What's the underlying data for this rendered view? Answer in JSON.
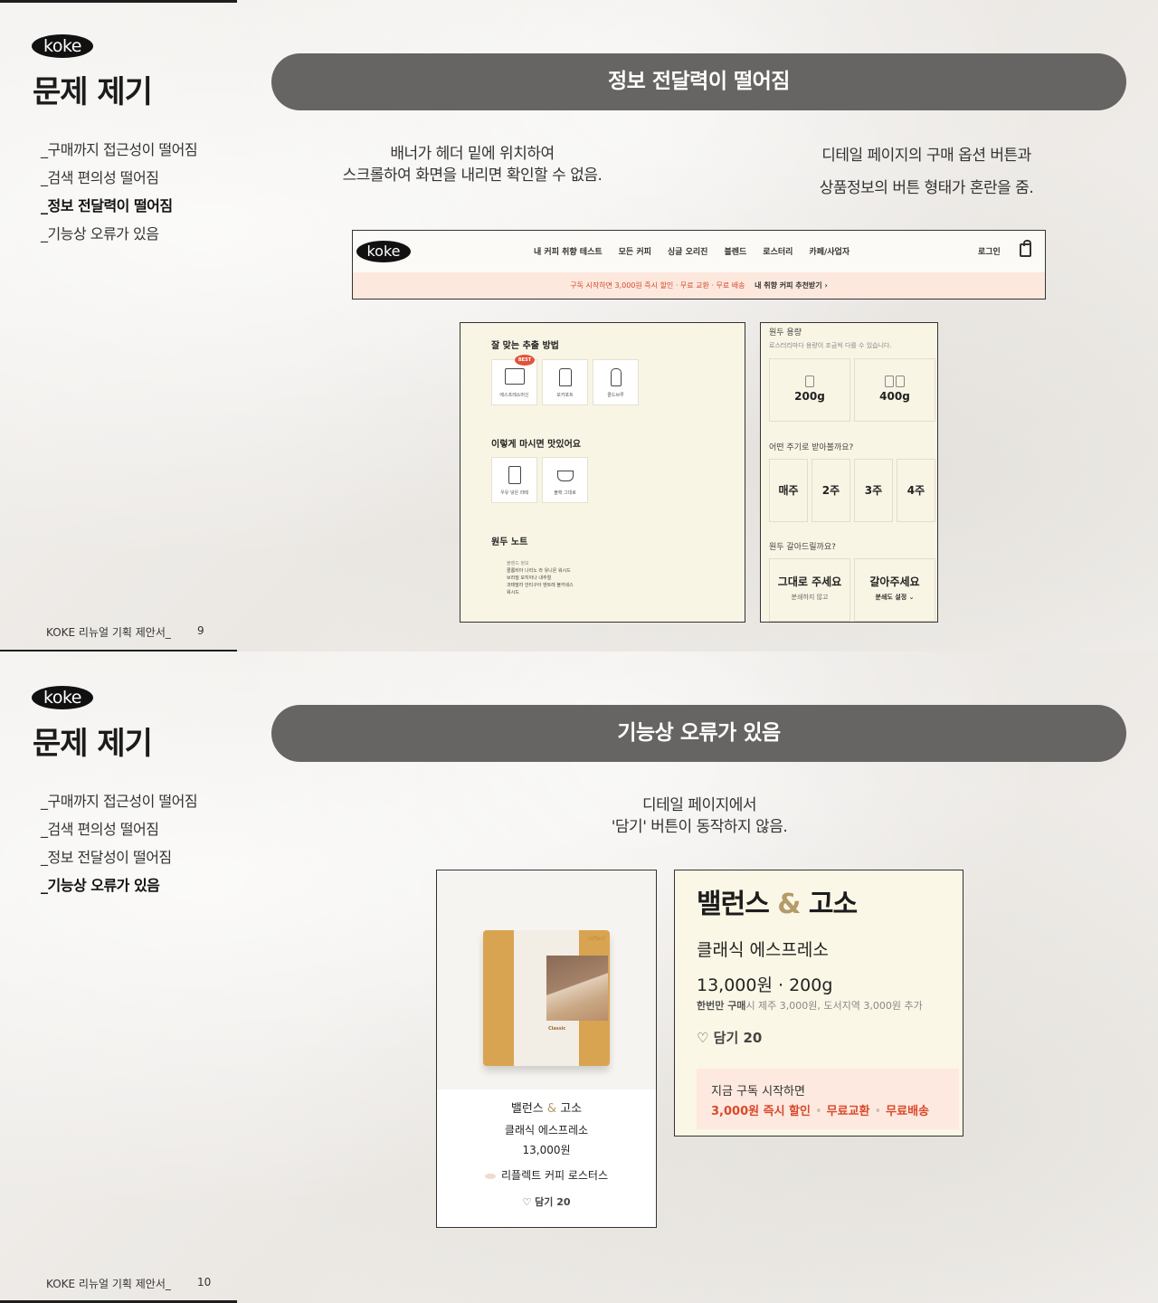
{
  "slides": [
    {
      "logo": "koke",
      "title": "문제 제기",
      "menu": [
        "_구매까지 접근성이 떨어짐",
        "_검색 편의성 떨어짐",
        "_정보 전달력이 떨어짐",
        "_기능상 오류가 있음"
      ],
      "active_index": 2,
      "footer": "KOKE 리뉴얼 기획 제안서_",
      "page_no": "9",
      "pill": "정보 전달력이 떨어짐",
      "desc_left": [
        "배너가 헤더 밑에 위치하여",
        "스크롤하여 화면을 내리면 확인할 수 없음."
      ],
      "desc_right": [
        "디테일 페이지의 구매 옵션 버튼과",
        "상품정보의 버튼 형태가 혼란을 줌."
      ],
      "header_mock": {
        "logo": "koke",
        "nav": [
          "내 커피 취향 테스트",
          "모든 커피",
          "싱글 오리진",
          "블렌드",
          "로스터리",
          "카페/사업자"
        ],
        "login": "로그인",
        "banner_text": "구독 시작하면 3,000원 즉시 할인 · 무료 교환 · 무료 배송",
        "banner_link": "내 취향 커피 추천받기 ›"
      },
      "brew_panel": {
        "h1": "잘 맞는 추출 방법",
        "best": "BEST",
        "methods": [
          "에스프레소머신",
          "모카포트",
          "콜드브루"
        ],
        "h2": "이렇게 마시면 맛있어요",
        "drinks": [
          "우유 넣은 라떼",
          "블랙 그대로"
        ],
        "h3": "원두 노트",
        "notes_title": "블렌드 정보",
        "notes": [
          "콜롬비아 나리노 라 유니온 워시드",
          "브라질 모지아나 내추럴",
          "과테말라 안티구아 엔트레 볼카네스",
          "워시드"
        ]
      },
      "option_panel": {
        "h1": "원두 용량",
        "sub1": "로스터리마다 용량이 조금씩 다를 수 있습니다.",
        "sizes": [
          "200g",
          "400g"
        ],
        "h2": "어떤 주기로 받아볼까요?",
        "cycles": [
          "매주",
          "2주",
          "3주",
          "4주"
        ],
        "h3": "원두 갈아드릴까요?",
        "grind": [
          {
            "title": "그대로 주세요",
            "sub": "분쇄하지 않고"
          },
          {
            "title": "갈아주세요",
            "sub": "분쇄도 설정 ⌄"
          }
        ]
      }
    },
    {
      "logo": "koke",
      "title": "문제 제기",
      "menu": [
        "_구매까지 접근성이 떨어짐",
        "_검색 편의성 떨어짐",
        "_정보 전달성이 떨어짐",
        "_기능상 오류가 있음"
      ],
      "active_index": 3,
      "footer": "KOKE 리뉴얼 기획 제안서_",
      "page_no": "10",
      "pill": "기능상 오류가 있음",
      "desc": [
        "디테일 페이지에서",
        "'담기' 버튼이 동작하지 않음."
      ],
      "product_card": {
        "brand_on_bag": "reflect",
        "bag_label": "Classic",
        "name_a": "밸런스",
        "amp": "&",
        "name_b": "고소",
        "sub": "클래식 에스프레소",
        "price": "13,000원",
        "roaster": "리플렉트 커피 로스터스",
        "like": "♡ 담기 20"
      },
      "detail_card": {
        "name_a": "밸런스",
        "amp": "&",
        "name_b": "고소",
        "sub": "클래식 에스프레소",
        "price": "13,000원 · 200g",
        "note_bold": "한번만 구매",
        "note": "시 제주 3,000원, 도서지역 3,000원 추가",
        "like": "♡ 담기 20",
        "sub_line1": "지금 구독 시작하면",
        "sub_line2_a": "3,000원 즉시 할인",
        "sub_line2_b": "무료교환",
        "sub_line2_c": "무료배송"
      }
    }
  ]
}
